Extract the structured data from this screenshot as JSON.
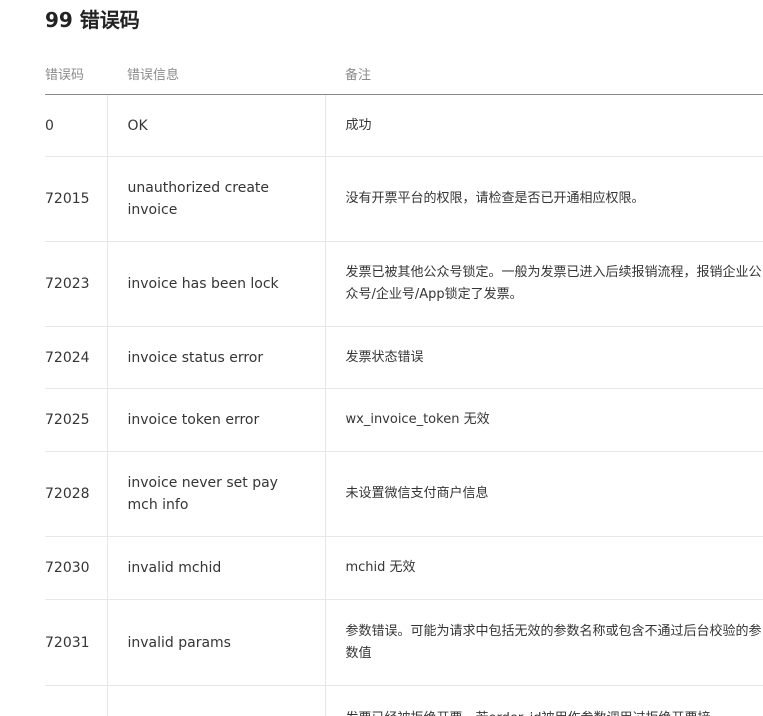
{
  "section": {
    "title": "99 错误码"
  },
  "table": {
    "headers": {
      "code": "错误码",
      "message": "错误信息",
      "note": "备注"
    },
    "rows": [
      {
        "code": "0",
        "message": "OK",
        "note": "成功"
      },
      {
        "code": "72015",
        "message": "unauthorized create invoice",
        "note": "没有开票平台的权限，请检查是否已开通相应权限。"
      },
      {
        "code": "72023",
        "message": "invoice has been lock",
        "note": "发票已被其他公众号锁定。一般为发票已进入后续报销流程，报销企业公众号/企业号/App锁定了发票。"
      },
      {
        "code": "72024",
        "message": "invoice status error",
        "note": "发票状态错误"
      },
      {
        "code": "72025",
        "message": "invoice token error",
        "note": "wx_invoice_token 无效"
      },
      {
        "code": "72028",
        "message": "invoice never set pay mch info",
        "note": "未设置微信支付商户信息"
      },
      {
        "code": "72030",
        "message": "invalid mchid",
        "note": "mchid 无效"
      },
      {
        "code": "72031",
        "message": "invalid params",
        "note": "参数错误。可能为请求中包括无效的参数名称或包含不通过后台校验的参数值"
      },
      {
        "code": "",
        "message": "",
        "note": "发票已经被拒绝开票。若order_id被用作参数调用过拒绝开票接"
      }
    ]
  }
}
